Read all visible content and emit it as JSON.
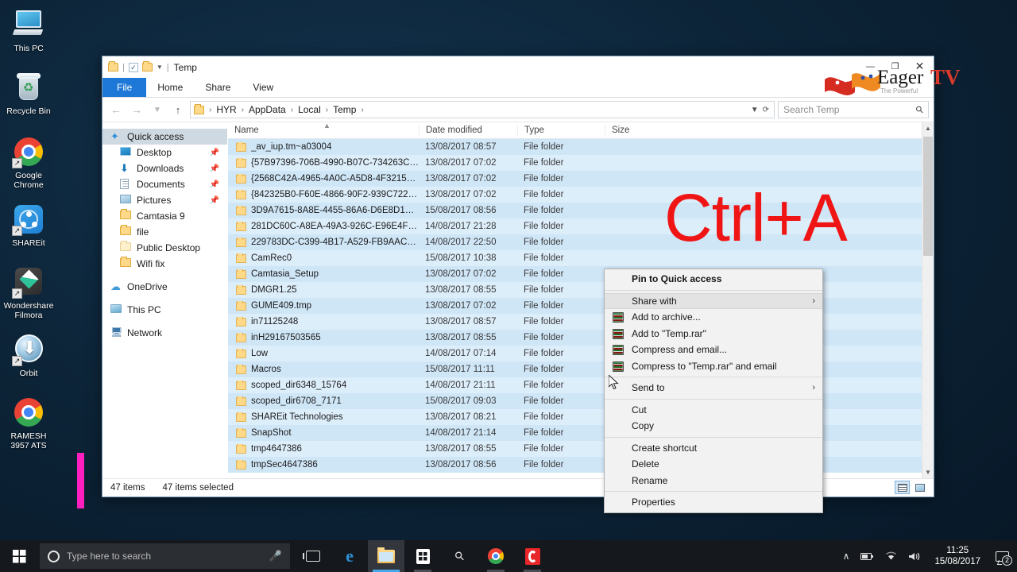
{
  "desktop": {
    "icons": [
      {
        "label": "This PC",
        "icon": "this-pc-icon"
      },
      {
        "label": "Recycle Bin",
        "icon": "recycle-bin-icon"
      },
      {
        "label": "Google Chrome",
        "icon": "google-chrome-icon"
      },
      {
        "label": "SHAREit",
        "icon": "shareit-icon"
      },
      {
        "label": "Wondershare Filmora",
        "icon": "wondershare-filmora-icon"
      },
      {
        "label": "Orbit",
        "icon": "orbit-downloader-icon"
      },
      {
        "label": "RAMESH 3957 ATS",
        "icon": "chrome-shortcut-icon"
      }
    ]
  },
  "explorer": {
    "title": "Temp",
    "quick_access_toolbar": {
      "properties_icon": "folder-properties-icon",
      "new_folder_icon": "new-folder-icon",
      "customize_icon": "customize-caret-icon"
    },
    "window_buttons": {
      "minimize": "—",
      "maximize": "❐",
      "close": "✕"
    },
    "ribbon_tabs": [
      {
        "label": "File",
        "active": true
      },
      {
        "label": "Home",
        "active": false
      },
      {
        "label": "Share",
        "active": false
      },
      {
        "label": "View",
        "active": false
      }
    ],
    "address": {
      "back_icon": "back-arrow-icon",
      "forward_icon": "forward-arrow-icon",
      "up_icon": "up-arrow-icon",
      "recent_icon": "recent-locations-icon",
      "refresh_icon": "refresh-icon",
      "breadcrumbs": [
        "HYR",
        "AppData",
        "Local",
        "Temp"
      ]
    },
    "search": {
      "placeholder": "Search Temp",
      "icon": "search-icon"
    },
    "navigation_pane": [
      {
        "label": "Quick access",
        "icon": "quick-access-star-icon",
        "selected": true,
        "indent": false,
        "pinned": false
      },
      {
        "label": "Desktop",
        "icon": "desktop-icon",
        "selected": false,
        "indent": true,
        "pinned": true
      },
      {
        "label": "Downloads",
        "icon": "downloads-icon",
        "selected": false,
        "indent": true,
        "pinned": true
      },
      {
        "label": "Documents",
        "icon": "documents-icon",
        "selected": false,
        "indent": true,
        "pinned": true
      },
      {
        "label": "Pictures",
        "icon": "pictures-icon",
        "selected": false,
        "indent": true,
        "pinned": true
      },
      {
        "label": "Camtasia 9",
        "icon": "folder-icon",
        "selected": false,
        "indent": true,
        "pinned": false
      },
      {
        "label": "file",
        "icon": "folder-icon",
        "selected": false,
        "indent": true,
        "pinned": false
      },
      {
        "label": "Public Desktop",
        "icon": "folder-pale-icon",
        "selected": false,
        "indent": true,
        "pinned": false
      },
      {
        "label": "Wifi fix",
        "icon": "folder-icon",
        "selected": false,
        "indent": true,
        "pinned": false
      },
      {
        "label": "OneDrive",
        "icon": "onedrive-cloud-icon",
        "selected": false,
        "indent": false,
        "pinned": false,
        "gap_before": true
      },
      {
        "label": "This PC",
        "icon": "this-pc-icon",
        "selected": false,
        "indent": false,
        "pinned": false,
        "gap_before": true
      },
      {
        "label": "Network",
        "icon": "network-icon",
        "selected": false,
        "indent": false,
        "pinned": false,
        "gap_before": true
      }
    ],
    "columns": [
      {
        "label": "Name",
        "key": "name",
        "sorted": "ascending"
      },
      {
        "label": "Date modified",
        "key": "date"
      },
      {
        "label": "Type",
        "key": "type"
      },
      {
        "label": "Size",
        "key": "size"
      }
    ],
    "files": [
      {
        "name": "_av_iup.tm~a03004",
        "date": "13/08/2017 08:57",
        "type": "File folder",
        "size": ""
      },
      {
        "name": "{57B97396-706B-4990-B07C-734263C54F5...",
        "date": "13/08/2017 07:02",
        "type": "File folder",
        "size": ""
      },
      {
        "name": "{2568C42A-4965-4A0C-A5D8-4F321546C...",
        "date": "13/08/2017 07:02",
        "type": "File folder",
        "size": ""
      },
      {
        "name": "{842325B0-F60E-4866-90F2-939C7227CCF...",
        "date": "13/08/2017 07:02",
        "type": "File folder",
        "size": ""
      },
      {
        "name": "3D9A7615-8A8E-4455-86A6-D6E8D18882F2",
        "date": "15/08/2017 08:56",
        "type": "File folder",
        "size": ""
      },
      {
        "name": "281DC60C-A8EA-49A3-926C-E96E4F3B4C...",
        "date": "14/08/2017 21:28",
        "type": "File folder",
        "size": ""
      },
      {
        "name": "229783DC-C399-4B17-A529-FB9AAC11B...",
        "date": "14/08/2017 22:50",
        "type": "File folder",
        "size": ""
      },
      {
        "name": "CamRec0",
        "date": "15/08/2017 10:38",
        "type": "File folder",
        "size": ""
      },
      {
        "name": "Camtasia_Setup",
        "date": "13/08/2017 07:02",
        "type": "File folder",
        "size": ""
      },
      {
        "name": "DMGR1.25",
        "date": "13/08/2017 08:55",
        "type": "File folder",
        "size": ""
      },
      {
        "name": "GUME409.tmp",
        "date": "13/08/2017 07:02",
        "type": "File folder",
        "size": ""
      },
      {
        "name": "in71125248",
        "date": "13/08/2017 08:57",
        "type": "File folder",
        "size": ""
      },
      {
        "name": "inH29167503565",
        "date": "13/08/2017 08:55",
        "type": "File folder",
        "size": ""
      },
      {
        "name": "Low",
        "date": "14/08/2017 07:14",
        "type": "File folder",
        "size": ""
      },
      {
        "name": "Macros",
        "date": "15/08/2017 11:11",
        "type": "File folder",
        "size": ""
      },
      {
        "name": "scoped_dir6348_15764",
        "date": "14/08/2017 21:11",
        "type": "File folder",
        "size": ""
      },
      {
        "name": "scoped_dir6708_7171",
        "date": "15/08/2017 09:03",
        "type": "File folder",
        "size": ""
      },
      {
        "name": "SHAREit Technologies",
        "date": "13/08/2017 08:21",
        "type": "File folder",
        "size": ""
      },
      {
        "name": "SnapShot",
        "date": "14/08/2017 21:14",
        "type": "File folder",
        "size": ""
      },
      {
        "name": "tmp4647386",
        "date": "13/08/2017 08:55",
        "type": "File folder",
        "size": ""
      },
      {
        "name": "tmpSec4647386",
        "date": "13/08/2017 08:56",
        "type": "File folder",
        "size": ""
      }
    ],
    "status": {
      "item_count": "47 items",
      "selection": "47 items selected"
    },
    "view_buttons": [
      {
        "name": "details-view-button",
        "icon": "details-view-icon",
        "active": true
      },
      {
        "name": "large-icons-view-button",
        "icon": "large-icons-view-icon",
        "active": false
      }
    ]
  },
  "context_menu": {
    "items": [
      {
        "label": "Pin to Quick access",
        "bold": true,
        "icon": null,
        "submenu": false,
        "highlighted": false
      },
      {
        "separator": true
      },
      {
        "label": "Share with",
        "bold": false,
        "icon": null,
        "submenu": true,
        "highlighted": true
      },
      {
        "label": "Add to archive...",
        "bold": false,
        "icon": "winrar-icon",
        "submenu": false,
        "highlighted": false
      },
      {
        "label": "Add to \"Temp.rar\"",
        "bold": false,
        "icon": "winrar-icon",
        "submenu": false,
        "highlighted": false
      },
      {
        "label": "Compress and email...",
        "bold": false,
        "icon": "winrar-icon",
        "submenu": false,
        "highlighted": false
      },
      {
        "label": "Compress to \"Temp.rar\" and email",
        "bold": false,
        "icon": "winrar-icon",
        "submenu": false,
        "highlighted": false
      },
      {
        "separator": true
      },
      {
        "label": "Send to",
        "bold": false,
        "icon": null,
        "submenu": true,
        "highlighted": false
      },
      {
        "separator": true
      },
      {
        "label": "Cut",
        "bold": false,
        "icon": null,
        "submenu": false,
        "highlighted": false
      },
      {
        "label": "Copy",
        "bold": false,
        "icon": null,
        "submenu": false,
        "highlighted": false
      },
      {
        "separator": true
      },
      {
        "label": "Create shortcut",
        "bold": false,
        "icon": null,
        "submenu": false,
        "highlighted": false
      },
      {
        "label": "Delete",
        "bold": false,
        "icon": null,
        "submenu": false,
        "highlighted": false
      },
      {
        "label": "Rename",
        "bold": false,
        "icon": null,
        "submenu": false,
        "highlighted": false
      },
      {
        "separator": true
      },
      {
        "label": "Properties",
        "bold": false,
        "icon": null,
        "submenu": false,
        "highlighted": false
      }
    ],
    "submenu_arrow": "›"
  },
  "overlay": {
    "shortcut_text": "Ctrl+A",
    "color": "#f01515"
  },
  "watermark": {
    "name": "Eager",
    "suffix": "TV",
    "tagline": "The Powerful"
  },
  "taskbar": {
    "start_icon": "windows-start-icon",
    "search": {
      "placeholder": "Type here to search",
      "cortana_icon": "cortana-circle-icon",
      "mic_icon": "microphone-icon"
    },
    "buttons": [
      {
        "name": "task-view-button",
        "icon": "task-view-icon",
        "state": "idle"
      },
      {
        "name": "microsoft-edge-button",
        "icon": "edge-icon",
        "state": "idle"
      },
      {
        "name": "file-explorer-button",
        "icon": "file-explorer-icon",
        "state": "active"
      },
      {
        "name": "microsoft-store-button",
        "icon": "store-icon",
        "state": "running"
      },
      {
        "name": "search-everything-button",
        "icon": "search-icon",
        "state": "idle"
      },
      {
        "name": "chrome-taskbar-button",
        "icon": "chrome-icon",
        "state": "running"
      },
      {
        "name": "camtasia-button",
        "icon": "camtasia-icon",
        "state": "running"
      }
    ],
    "tray": [
      {
        "name": "show-hidden-icons",
        "glyph": "∧"
      },
      {
        "name": "battery-icon",
        "glyph": "🔋"
      },
      {
        "name": "wifi-icon",
        "glyph": "◠"
      },
      {
        "name": "volume-icon",
        "glyph": "🔊"
      }
    ],
    "clock": {
      "time": "11:25",
      "date": "15/08/2017"
    },
    "notifications": {
      "count": "2",
      "icon": "action-center-icon"
    }
  }
}
